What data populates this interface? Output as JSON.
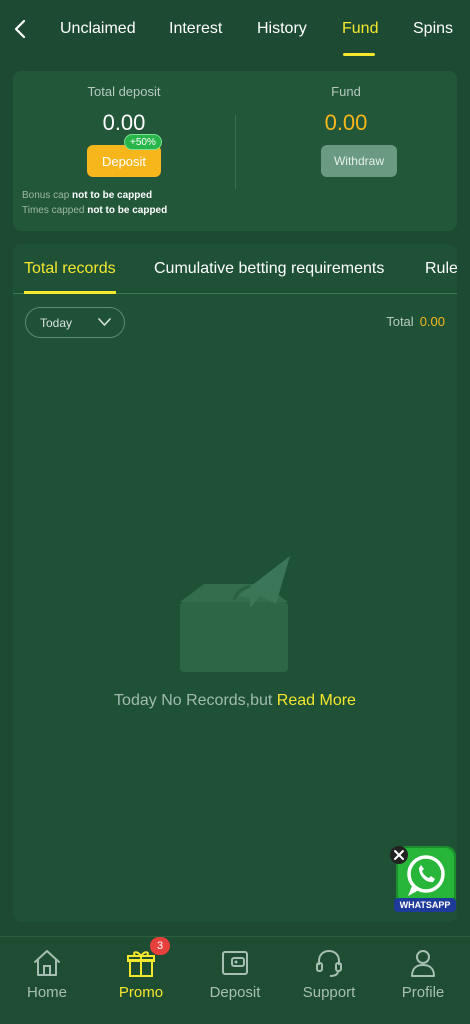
{
  "top_tabs": {
    "items": [
      "Unclaimed",
      "Interest",
      "History",
      "Fund",
      "Spins"
    ],
    "active": "Fund"
  },
  "card": {
    "total_deposit_label": "Total deposit",
    "total_deposit_value": "0.00",
    "deposit_badge": "+50%",
    "deposit_button": "Deposit",
    "fund_label": "Fund",
    "fund_value": "0.00",
    "withdraw_button": "Withdraw",
    "bonus_cap_label": "Bonus cap",
    "bonus_cap_value": "not to be capped",
    "times_capped_label": "Times capped",
    "times_capped_value": "not to be capped"
  },
  "records": {
    "tabs": [
      "Total records",
      "Cumulative betting requirements",
      "Rule"
    ],
    "active_tab": "Total records",
    "filter_selected": "Today",
    "total_label": "Total",
    "total_value": "0.00",
    "empty_text": "Today No Records,but ",
    "read_more": "Read More"
  },
  "whatsapp": {
    "label": "WHATSAPP"
  },
  "bottom_nav": {
    "items": [
      "Home",
      "Promo",
      "Deposit",
      "Support",
      "Profile"
    ],
    "active": "Promo",
    "promo_badge": "3"
  },
  "colors": {
    "background": "#1c4a32",
    "accent_yellow": "#f5e62e",
    "gold": "#f6b61c",
    "badge_red": "#e5403b",
    "badge_green": "#28b54a"
  },
  "icons": {
    "back": "chevron-left-icon",
    "filter": "chevron-down-icon",
    "empty": "empty-box-paper-plane-icon",
    "home": "home-icon",
    "promo": "gift-icon",
    "deposit": "wallet-icon",
    "support": "headset-icon",
    "profile": "user-icon",
    "whatsapp": "whatsapp-icon",
    "close": "close-icon"
  }
}
